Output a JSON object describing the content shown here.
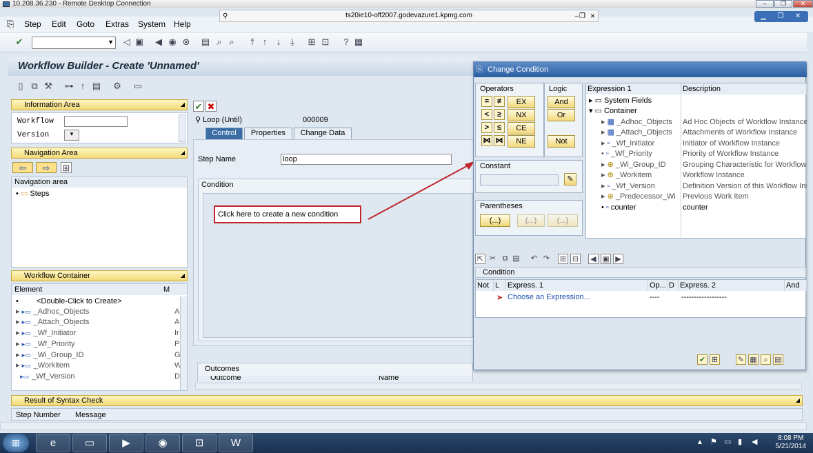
{
  "rdc": {
    "title": "10.208.36.230 - Remote Desktop Connection"
  },
  "session": {
    "host": "ts20ie10-off2007.godevazure1.kpmg.com"
  },
  "menu": [
    "Step",
    "Edit",
    "Goto",
    "Extras",
    "System",
    "Help"
  ],
  "page": {
    "title": "Workflow Builder - Create 'Unnamed'"
  },
  "info_area": {
    "header": "Information Area",
    "workflow_label": "Workflow",
    "version_label": "Version"
  },
  "nav_area": {
    "header": "Navigation Area",
    "list_header": "Navigation area",
    "steps": "Steps"
  },
  "wf_container": {
    "header": "Workflow Container",
    "col_element": "Element",
    "col_m": "M",
    "rows": [
      {
        "label": "<Double-Click to Create>",
        "m": ""
      },
      {
        "label": "_Adhoc_Objects",
        "m": "A"
      },
      {
        "label": "_Attach_Objects",
        "m": "A"
      },
      {
        "label": "_Wf_Initiator",
        "m": "Ir"
      },
      {
        "label": "_Wf_Priority",
        "m": "P"
      },
      {
        "label": "_Wi_Group_ID",
        "m": "G"
      },
      {
        "label": "_Workitem",
        "m": "W"
      },
      {
        "label": "_Wf_Version",
        "m": "D"
      }
    ]
  },
  "step": {
    "type": "Loop (Until)",
    "number": "000009",
    "name_label": "Step Name",
    "name_value": "loop",
    "condition_label": "Condition",
    "outcomes_label": "Outcomes",
    "outcomes_col1": "Outcome",
    "outcomes_col2": "Name"
  },
  "tabs": [
    "Control",
    "Properties",
    "Change Data"
  ],
  "annotation": {
    "text": "Click here to create a new condition"
  },
  "dialog": {
    "title": "Change Condition",
    "operators_label": "Operators",
    "logic_label": "Logic",
    "operators": [
      "=",
      "≠",
      "<",
      "≥",
      ">",
      "≤",
      "⋈",
      "⋈"
    ],
    "op_words": [
      "EX",
      "NX",
      "CE",
      "NE"
    ],
    "logic": [
      "And",
      "Or",
      "Not"
    ],
    "constant_label": "Constant",
    "parentheses_label": "Parentheses",
    "paren_btns": [
      "(...)",
      "(...)",
      "(...)"
    ],
    "expr_col1": "Expression 1",
    "expr_col2": "Description",
    "expr_rows": [
      {
        "label": "System Fields",
        "desc": ""
      },
      {
        "label": "Container",
        "desc": ""
      },
      {
        "label": "_Adhoc_Objects",
        "desc": "Ad Hoc Objects of Workflow Instance"
      },
      {
        "label": "_Attach_Objects",
        "desc": "Attachments of Workflow Instance"
      },
      {
        "label": "_Wf_Initiator",
        "desc": "Initiator of Workflow Instance"
      },
      {
        "label": "_Wf_Priority",
        "desc": "Priority of Workflow Instance"
      },
      {
        "label": "_Wi_Group_ID",
        "desc": "Grouping Characteristic for Workflow I"
      },
      {
        "label": "_Workitem",
        "desc": "Workflow Instance"
      },
      {
        "label": "_Wf_Version",
        "desc": "Definition Version of this Workflow Ins"
      },
      {
        "label": "_Predecessor_Wi",
        "desc": "Previous Work Item"
      },
      {
        "label": "counter",
        "desc": "counter"
      }
    ],
    "cond_label": "Condition",
    "cond_cols": [
      "Not",
      "L",
      "Express. 1",
      "Op...",
      "D",
      "Express. 2",
      "And"
    ],
    "cond_row": {
      "expr1": "Choose an Expression...",
      "op": "----",
      "expr2": "------------------"
    }
  },
  "syntax": {
    "header": "Result of Syntax Check",
    "col1": "Step Number",
    "col2": "Message"
  },
  "clock": {
    "time": "8:08 PM",
    "date": "5/21/2014"
  }
}
